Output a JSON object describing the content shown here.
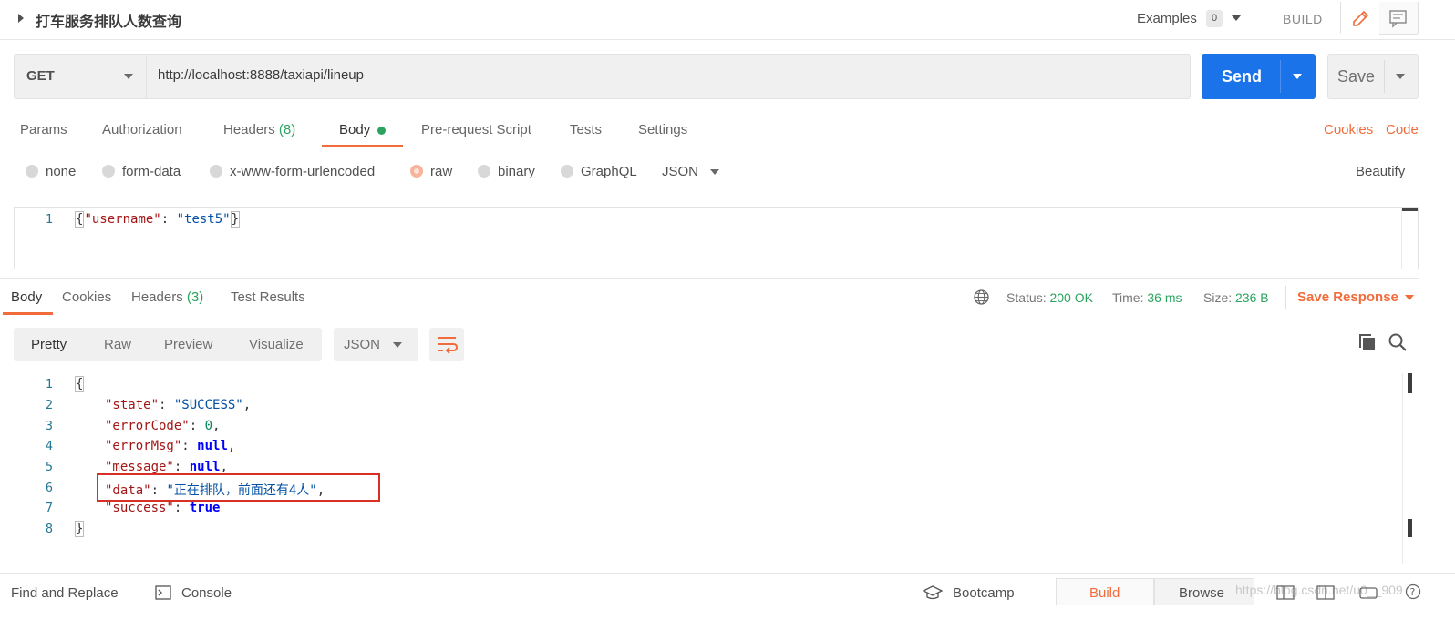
{
  "request": {
    "name": "打车服务排队人数查询",
    "examples_label": "Examples",
    "examples_count": "0",
    "build_label": "BUILD",
    "method": "GET",
    "url": "http://localhost:8888/taxiapi/lineup",
    "send_label": "Send",
    "save_label": "Save"
  },
  "request_tabs": {
    "params": "Params",
    "authorization": "Authorization",
    "headers": "Headers",
    "headers_count": "(8)",
    "body": "Body",
    "pre_request": "Pre-request Script",
    "tests": "Tests",
    "settings": "Settings",
    "cookies": "Cookies",
    "code": "Code"
  },
  "body_types": {
    "none": "none",
    "form_data": "form-data",
    "urlencoded": "x-www-form-urlencoded",
    "raw": "raw",
    "binary": "binary",
    "graphql": "GraphQL",
    "format": "JSON",
    "beautify": "Beautify",
    "selected": "raw"
  },
  "request_body": {
    "line_no": "1",
    "key": "\"username\"",
    "colon": ": ",
    "value": "\"test5\""
  },
  "response_tabs": {
    "body": "Body",
    "cookies": "Cookies",
    "headers": "Headers",
    "headers_count": "(3)",
    "test_results": "Test Results"
  },
  "response_meta": {
    "status_label": "Status:",
    "status_value": "200 OK",
    "time_label": "Time:",
    "time_value": "36 ms",
    "size_label": "Size:",
    "size_value": "236 B",
    "save_response": "Save Response"
  },
  "response_view": {
    "pretty": "Pretty",
    "raw": "Raw",
    "preview": "Preview",
    "visualize": "Visualize",
    "format": "JSON"
  },
  "response_body": {
    "line_numbers": [
      "1",
      "2",
      "3",
      "4",
      "5",
      "6",
      "7",
      "8"
    ],
    "open_brace": "{",
    "close_brace": "}",
    "state_key": "\"state\"",
    "state_value": "\"SUCCESS\"",
    "errorCode_key": "\"errorCode\"",
    "errorCode_value": "0",
    "errorMsg_key": "\"errorMsg\"",
    "errorMsg_value": "null",
    "message_key": "\"message\"",
    "message_value": "null",
    "data_key": "\"data\"",
    "data_value": "\"正在排队，前面还有4人\"",
    "success_key": "\"success\"",
    "success_value": "true"
  },
  "status_bar": {
    "find_replace": "Find and Replace",
    "console": "Console",
    "bootcamp": "Bootcamp",
    "build": "Build",
    "browse": "Browse",
    "watermark": "https://blog.csdn.net/u0__909"
  },
  "colors": {
    "accent_orange": "#f26b3a",
    "send_blue": "#1a73e8",
    "success_green": "#2ba360",
    "highlight_red": "#d93025"
  }
}
